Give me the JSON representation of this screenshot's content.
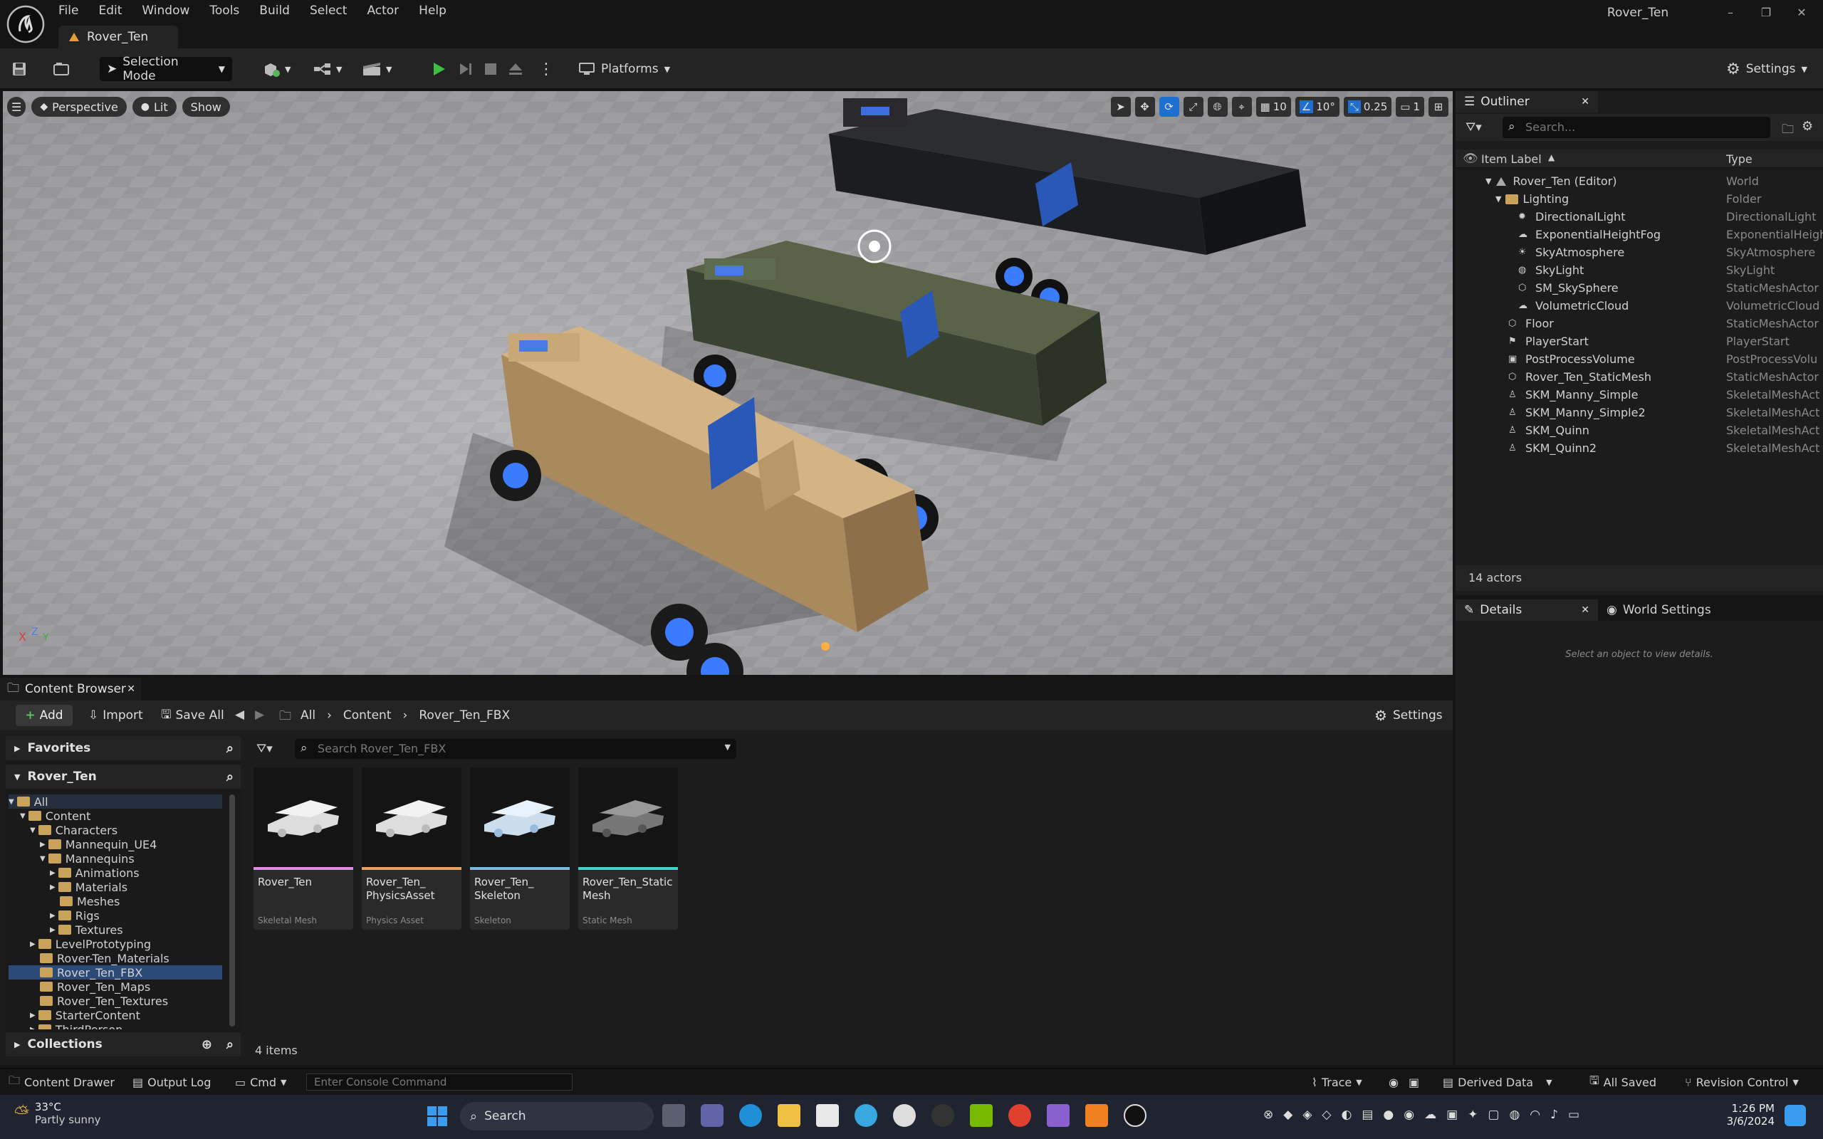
{
  "app": {
    "window_title": "Rover_Ten",
    "doc_tab": "Rover_Ten",
    "menu": [
      "File",
      "Edit",
      "Window",
      "Tools",
      "Build",
      "Select",
      "Actor",
      "Help"
    ]
  },
  "toolbar": {
    "selection_mode": "Selection Mode",
    "platforms": "Platforms",
    "settings": "Settings"
  },
  "viewport": {
    "perspective": "Perspective",
    "lit": "Lit",
    "show": "Show",
    "grid_snap": "10",
    "rotation_snap": "10°",
    "scale_snap": "0.25",
    "camera_speed": "1"
  },
  "outliner": {
    "tab": "Outliner",
    "search_placeholder": "Search...",
    "col_label": "Item Label",
    "col_type": "Type",
    "rows": [
      {
        "label": "Rover_Ten (Editor)",
        "type": "World"
      },
      {
        "label": "Lighting",
        "type": "Folder"
      },
      {
        "label": "DirectionalLight",
        "type": "DirectionalLight"
      },
      {
        "label": "ExponentialHeightFog",
        "type": "ExponentialHeigh"
      },
      {
        "label": "SkyAtmosphere",
        "type": "SkyAtmosphere"
      },
      {
        "label": "SkyLight",
        "type": "SkyLight"
      },
      {
        "label": "SM_SkySphere",
        "type": "StaticMeshActor"
      },
      {
        "label": "VolumetricCloud",
        "type": "VolumetricCloud"
      },
      {
        "label": "Floor",
        "type": "StaticMeshActor"
      },
      {
        "label": "PlayerStart",
        "type": "PlayerStart"
      },
      {
        "label": "PostProcessVolume",
        "type": "PostProcessVolu"
      },
      {
        "label": "Rover_Ten_StaticMesh",
        "type": "StaticMeshActor"
      },
      {
        "label": "SKM_Manny_Simple",
        "type": "SkeletalMeshAct"
      },
      {
        "label": "SKM_Manny_Simple2",
        "type": "SkeletalMeshAct"
      },
      {
        "label": "SKM_Quinn",
        "type": "SkeletalMeshAct"
      },
      {
        "label": "SKM_Quinn2",
        "type": "SkeletalMeshAct"
      }
    ],
    "count": "14 actors"
  },
  "details": {
    "tab": "Details",
    "world_settings": "World Settings",
    "empty": "Select an object to view details."
  },
  "content_browser": {
    "tab": "Content Browser",
    "add": "Add",
    "import": "Import",
    "save_all": "Save All",
    "breadcrumb": [
      "All",
      "Content",
      "Rover_Ten_FBX"
    ],
    "settings": "Settings",
    "favorites": "Favorites",
    "project": "Rover_Ten",
    "collections": "Collections",
    "search_placeholder": "Search Rover_Ten_FBX",
    "item_count": "4 items",
    "tree": [
      {
        "label": "All"
      },
      {
        "label": "Content"
      },
      {
        "label": "Characters"
      },
      {
        "label": "Mannequin_UE4"
      },
      {
        "label": "Mannequins"
      },
      {
        "label": "Animations"
      },
      {
        "label": "Materials"
      },
      {
        "label": "Meshes"
      },
      {
        "label": "Rigs"
      },
      {
        "label": "Textures"
      },
      {
        "label": "LevelPrototyping"
      },
      {
        "label": "Rover-Ten_Materials"
      },
      {
        "label": "Rover_Ten_FBX"
      },
      {
        "label": "Rover_Ten_Maps"
      },
      {
        "label": "Rover_Ten_Textures"
      },
      {
        "label": "StarterContent"
      },
      {
        "label": "ThirdPerson"
      }
    ],
    "assets": [
      {
        "name": "Rover_Ten",
        "kind": "Skeletal Mesh",
        "color": "#e089e0"
      },
      {
        "name": "Rover_Ten_ PhysicsAsset",
        "kind": "Physics Asset",
        "color": "#e8a060"
      },
      {
        "name": "Rover_Ten_ Skeleton",
        "kind": "Skeleton",
        "color": "#7ab8e0"
      },
      {
        "name": "Rover_Ten_Static Mesh",
        "kind": "Static Mesh",
        "color": "#40d0c8"
      }
    ]
  },
  "statusbar": {
    "content_drawer": "Content Drawer",
    "output_log": "Output Log",
    "cmd": "Cmd",
    "console_placeholder": "Enter Console Command",
    "trace": "Trace",
    "derived_data": "Derived Data",
    "all_saved": "All Saved",
    "revision_control": "Revision Control"
  },
  "taskbar": {
    "temperature": "33°C",
    "weather": "Partly sunny",
    "search": "Search",
    "time": "1:26 PM",
    "date": "3/6/2024"
  }
}
